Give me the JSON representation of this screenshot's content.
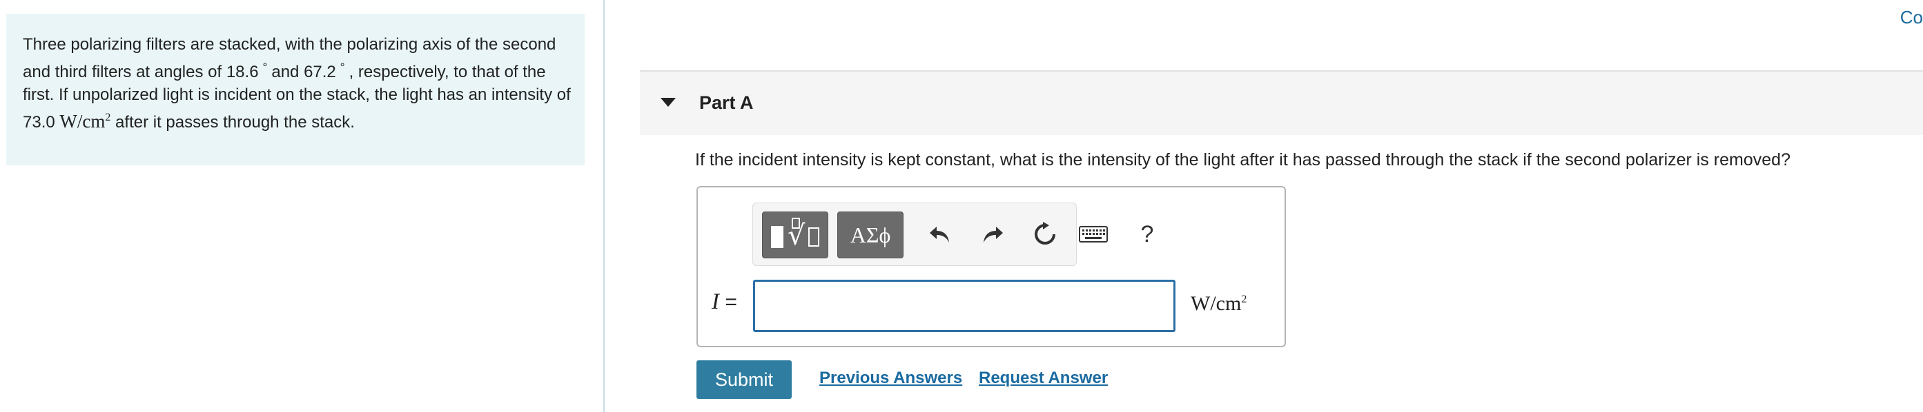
{
  "problem": {
    "text_1": "Three polarizing filters are stacked, with the polarizing axis of the second and third filters at angles of 18.6",
    "degree_symbol": "°",
    "text_2": "and 67.2",
    "text_3": ", respectively, to that of the first. If unpolarized light is incident on the stack, the light has an intensity of 73.0",
    "intensity_unit_base": "W/cm",
    "intensity_unit_exp": "2",
    "text_4": "after it passes through the stack."
  },
  "top_link": {
    "label": "Co"
  },
  "part": {
    "title": "Part A"
  },
  "question": "If the incident intensity is kept constant, what is the intensity of the light after it has passed through the stack if the second polarizer is removed?",
  "toolbar": {
    "symbols_label": "ΑΣϕ",
    "help_label": "?"
  },
  "answer": {
    "variable": "I",
    "equals": "=",
    "value": "",
    "unit_base": "W/cm",
    "unit_exp": "2"
  },
  "actions": {
    "submit_label": "Submit",
    "previous_answers_label": "Previous Answers",
    "request_answer_label": "Request Answer"
  },
  "colors": {
    "panel_bg": "#e9f5f7",
    "link": "#1a6aa0",
    "submit_bg": "#2f7ea1",
    "input_border": "#2b6fa6"
  },
  "icons": [
    "caret-down-icon",
    "templates-icon",
    "undo-icon",
    "redo-icon",
    "reset-icon",
    "keyboard-icon",
    "help-icon"
  ]
}
